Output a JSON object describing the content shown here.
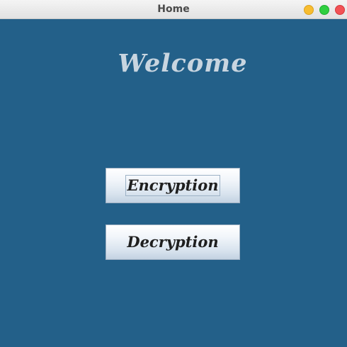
{
  "window": {
    "title": "Home"
  },
  "main": {
    "welcome_text": "Welcome",
    "encryption_label": "Encryption",
    "decryption_label": "Decryption"
  },
  "colors": {
    "background": "#236089",
    "welcome_text": "#c8d5e0",
    "close": "#f25256",
    "minimize": "#f8bd30",
    "maximize": "#2fcf40"
  }
}
